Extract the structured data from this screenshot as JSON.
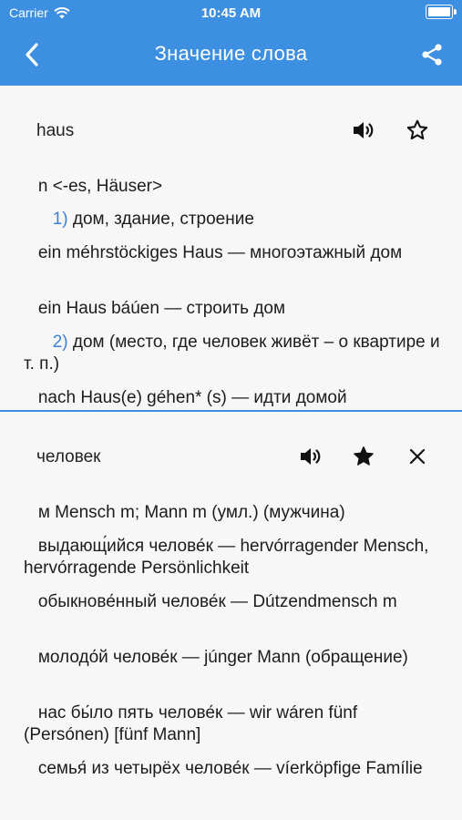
{
  "status_bar": {
    "carrier": "Carrier",
    "time": "10:45 AM"
  },
  "nav": {
    "title": "Значение слова",
    "back_icon": "chevron-left-icon",
    "share_icon": "share-icon"
  },
  "colors": {
    "accent": "#3d8fe2",
    "number": "#3d7fd9"
  },
  "top_card": {
    "word": "haus",
    "favorite": false,
    "lines": [
      {
        "indent": "   ",
        "num": "",
        "text": "n <-es, Häuser>"
      },
      {
        "indent": "      ",
        "num": "1)",
        "text": " дом, здание, строение"
      },
      {
        "indent": "   ",
        "num": "",
        "text": "ein méhrstöckiges Haus — многоэтажный дом"
      },
      {
        "indent": "   ",
        "num": "",
        "text": "ein Haus báúen — строить дом"
      },
      {
        "indent": "      ",
        "num": "2)",
        "text": " дом (место, где человек живёт – о квартире и т. п.)"
      },
      {
        "indent": "   ",
        "num": "",
        "text": "nach Haus(e) géhen* (s) — идти домой"
      }
    ]
  },
  "bottom_card": {
    "word": "человек",
    "favorite": true,
    "lines": [
      {
        "indent": "   ",
        "num": "",
        "text": "м Mensch m; Mann m (умл.) (мужчина)"
      },
      {
        "indent": "   ",
        "num": "",
        "text": "выдающ́ийся челове́к — hervórragender Mensch, hervórragende Persönlichkeit"
      },
      {
        "indent": "   ",
        "num": "",
        "text": "обыкнове́нный челове́к — Dútzendmensch m"
      },
      {
        "indent": "   ",
        "num": "",
        "text": "молодо́й челове́к — júnger Mann (обращение)"
      },
      {
        "indent": "   ",
        "num": "",
        "text": "нас бы́ло пять челове́к — wir wáren fünf (Persónen) [fünf Mann]"
      },
      {
        "indent": "   ",
        "num": "",
        "text": "семья́ из четырёх челове́к — víerköpfige Famílie"
      }
    ]
  }
}
